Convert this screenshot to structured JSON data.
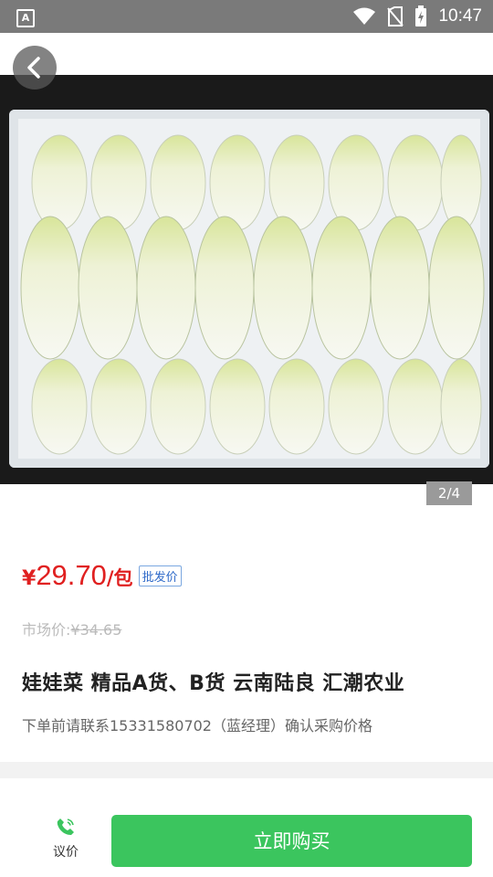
{
  "status_bar": {
    "time": "10:47",
    "app_icon_letter": "A"
  },
  "image_gallery": {
    "counter": "2/4",
    "alt": "napa cabbage in foam box"
  },
  "product": {
    "currency_symbol": "¥",
    "price": "29.70",
    "unit": "/包",
    "price_tag": "批发价",
    "market_price_label": "市场价:",
    "market_price": "¥34.65",
    "title": "娃娃菜 精品A货、B货 云南陆良 汇潮农业",
    "note": "下单前请联系15331580702（蓝经理）确认采购价格"
  },
  "bottom_bar": {
    "negotiate_label": "议价",
    "buy_label": "立即购买"
  },
  "colors": {
    "price": "#e02020",
    "buy_button": "#3bc55e",
    "tag_blue": "#2f6ac9"
  }
}
